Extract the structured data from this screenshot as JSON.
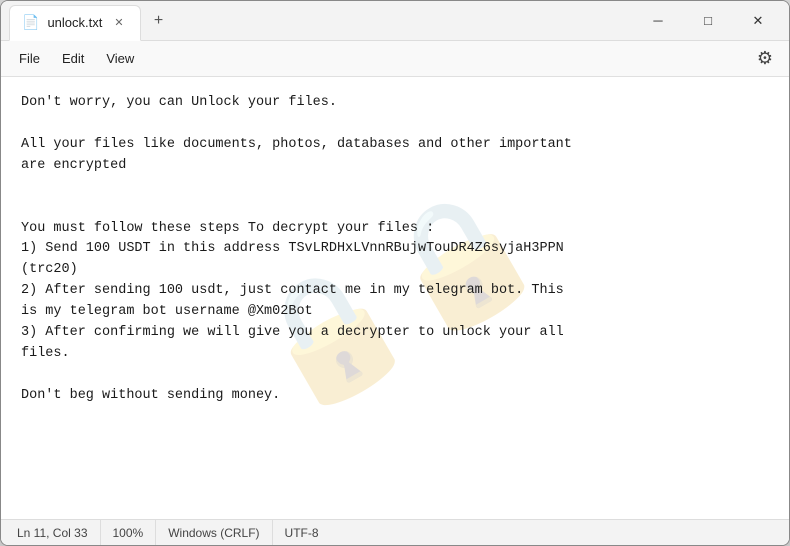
{
  "window": {
    "title": "unlock.txt",
    "tab_icon": "📄",
    "close_label": "✕",
    "minimize_label": "─",
    "maximize_label": "□",
    "new_tab_label": "+"
  },
  "menu": {
    "items": [
      "File",
      "Edit",
      "View"
    ],
    "settings_icon": "⚙"
  },
  "editor": {
    "content": "Don't worry, you can Unlock your files.\n\nAll your files like documents, photos, databases and other important\nare encrypted\n\n\nYou must follow these steps To decrypt your files :\n1) Send 100 USDT in this address TSvLRDHxLVnnRBujwTouDR4Z6syjaH3PPN\n(trc20)\n2) After sending 100 usdt, just contact me in my telegram bot. This\nis my telegram bot username @Xm02Bot\n3) After confirming we will give you a decrypter to unlock your all\nfiles.\n\nDon't beg without sending money.",
    "watermark": "🔒"
  },
  "status_bar": {
    "line_col": "Ln 11, Col 33",
    "zoom": "100%",
    "line_ending": "Windows (CRLF)",
    "encoding": "UTF-8"
  }
}
